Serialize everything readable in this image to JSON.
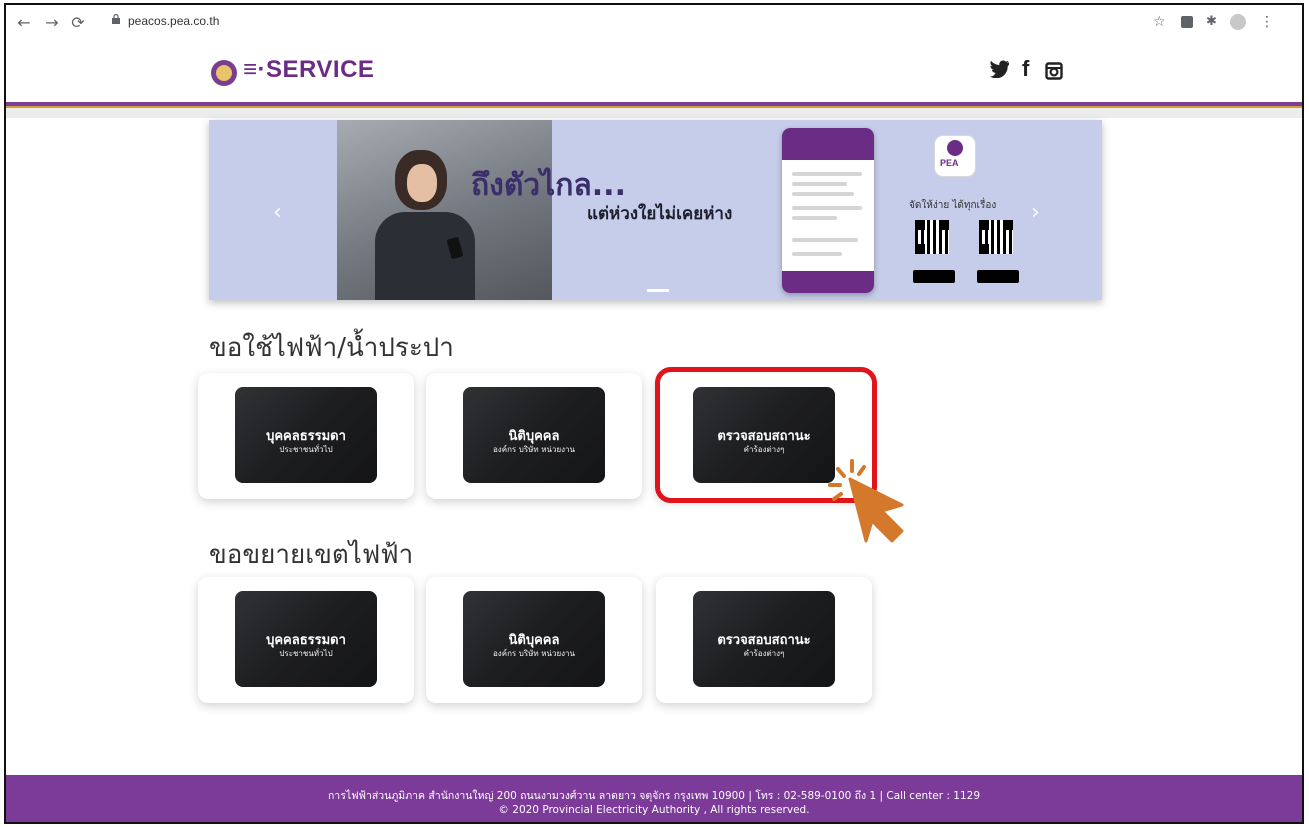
{
  "browser": {
    "back_icon": "arrow-left-icon",
    "forward_icon": "arrow-right-icon",
    "reload_icon": "reload-icon",
    "url": "peacos.pea.co.th"
  },
  "header": {
    "brand": "≡·SERVICE",
    "social": [
      "twitter-icon",
      "facebook-icon",
      "instagram-icon"
    ]
  },
  "banner": {
    "headline": "ถึงตัวไกล...",
    "subline": "แต่ห่วงใยไม่เคยห่าง",
    "app_label": "PEA",
    "tagline": "จัดให้ง่าย ได้ทุกเรื่อง",
    "prev_arrow": "‹",
    "next_arrow": "›"
  },
  "sections": [
    {
      "title": "ขอใช้ไฟฟ้า/น้ำประปา",
      "cards": [
        {
          "title": "บุคคลธรรมดา",
          "subtitle": "ประชาชนทั่วไป"
        },
        {
          "title": "นิติบุคคล",
          "subtitle": "องค์กร บริษัท หน่วยงาน"
        },
        {
          "title": "ตรวจสอบสถานะ",
          "subtitle": "คำร้องต่างๆ"
        }
      ]
    },
    {
      "title": "ขอขยายเขตไฟฟ้า",
      "cards": [
        {
          "title": "บุคคลธรรมดา",
          "subtitle": "ประชาชนทั่วไป"
        },
        {
          "title": "นิติบุคคล",
          "subtitle": "องค์กร บริษัท หน่วยงาน"
        },
        {
          "title": "ตรวจสอบสถานะ",
          "subtitle": "คำร้องต่างๆ"
        }
      ]
    }
  ],
  "footer": {
    "line1": "การไฟฟ้าส่วนภูมิภาค สำนักงานใหญ่ 200 ถนนงามวงศ์วาน ลาดยาว จตุจักร กรุงเทพ 10900  |  โทร : 02-589-0100 ถึง 1 |  Call center : 1129",
    "line2": "© 2020 Provincial Electricity Authority , All rights reserved."
  },
  "colors": {
    "brand_purple": "#7c3a99",
    "gold": "#c9a33a",
    "highlight_red": "#e1141b",
    "cursor_orange": "#d4782c"
  }
}
